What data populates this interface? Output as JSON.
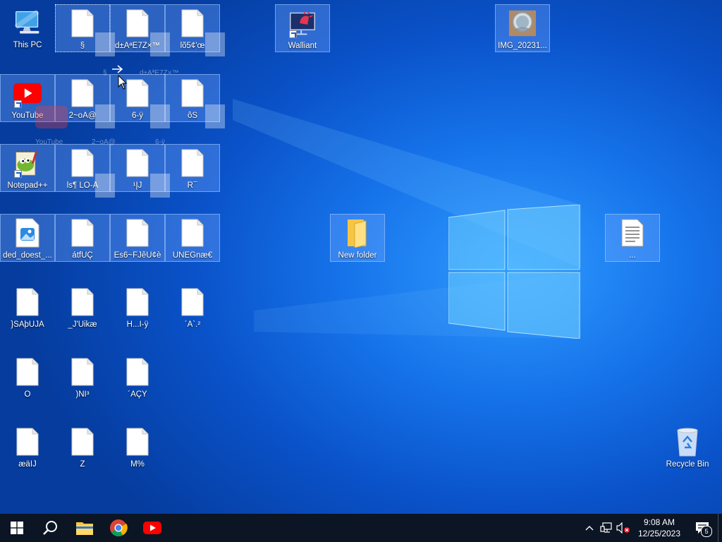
{
  "desktop": {
    "icons": [
      {
        "label": "This PC",
        "type": "pc"
      },
      {
        "label": "§",
        "type": "doc"
      },
      {
        "label": "d±AªE7Z×™",
        "type": "doc"
      },
      {
        "label": "lõ5¢'œ",
        "type": "doc"
      },
      {
        "label": "Walliant",
        "type": "walliant"
      },
      {
        "label": "IMG_20231...",
        "type": "image"
      },
      {
        "label": "YouTube",
        "type": "youtube"
      },
      {
        "label": "2~oA@",
        "type": "doc"
      },
      {
        "label": "6-ÿ",
        "type": "doc"
      },
      {
        "label": "ôŠ",
        "type": "doc"
      },
      {
        "label": "Notepad++",
        "type": "notepad"
      },
      {
        "label": "ls¶ LÖ-Å",
        "type": "doc"
      },
      {
        "label": "¹ĮJ",
        "type": "doc"
      },
      {
        "label": "R¯",
        "type": "doc"
      },
      {
        "label": "ded_doest_...",
        "type": "imgfile"
      },
      {
        "label": "átfÛÇ",
        "type": "doc"
      },
      {
        "label": "Ës6~FJêÙ¢è",
        "type": "doc"
      },
      {
        "label": "ÚÑÈGnæ€",
        "type": "doc"
      },
      {
        "label": "New folder",
        "type": "folder"
      },
      {
        "label": "...",
        "type": "textdoc"
      },
      {
        "label": "}ŠÂþUJÀ",
        "type": "doc"
      },
      {
        "label": "_J'Uikæ",
        "type": "doc"
      },
      {
        "label": "H...Î-ÿ",
        "type": "doc"
      },
      {
        "label": "´À`.²",
        "type": "doc"
      },
      {
        "label": "Ô",
        "type": "doc"
      },
      {
        "label": ")ÑÎ³",
        "type": "doc"
      },
      {
        "label": "´ÀÇY",
        "type": "doc"
      },
      {
        "label": "æäIJ",
        "type": "doc"
      },
      {
        "label": "Z",
        "type": "doc"
      },
      {
        "label": "M%",
        "type": "doc"
      },
      {
        "label": "Recycle Bin",
        "type": "recycle"
      }
    ],
    "drag_ghost_labels": [
      "§",
      "d±AªE7Z×™",
      "YouTube",
      "2~oA@",
      "6-ÿ"
    ]
  },
  "taskbar": {
    "apps": [
      "start-icon",
      "search-icon",
      "file-explorer-icon",
      "chrome-icon",
      "youtube-icon"
    ],
    "clock_time": "9:08 AM",
    "clock_date": "12/25/2023",
    "notification_count": "5"
  },
  "colors": {
    "taskbar": "#0c1524",
    "selection": "#76aaff",
    "youtube_red": "#ff0000",
    "folder_yellow": "#f6c544"
  }
}
